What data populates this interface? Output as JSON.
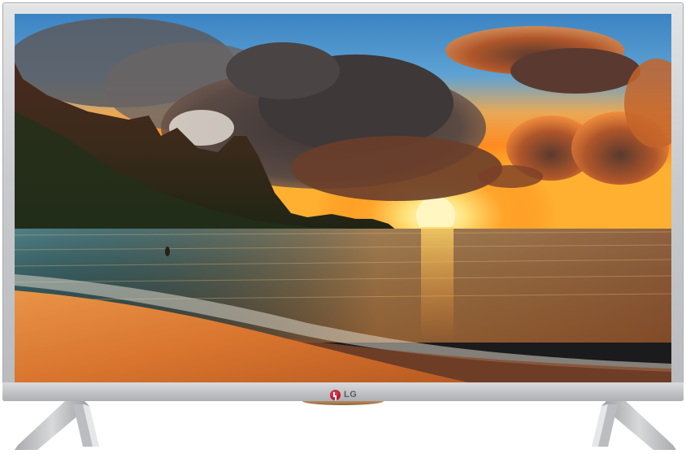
{
  "brand": {
    "name": "LG",
    "mark_color": "#b3122a"
  },
  "scene": {
    "subject": "sunset-over-sea",
    "sun_color": "#ffd24a",
    "sky_colors": [
      "#3a8fd0",
      "#f0a03a",
      "#ff7a1a"
    ],
    "sea_color": "#3f6f70",
    "sand_color": "#e48a3a"
  },
  "bezel": {
    "color": "#c9cacd"
  }
}
